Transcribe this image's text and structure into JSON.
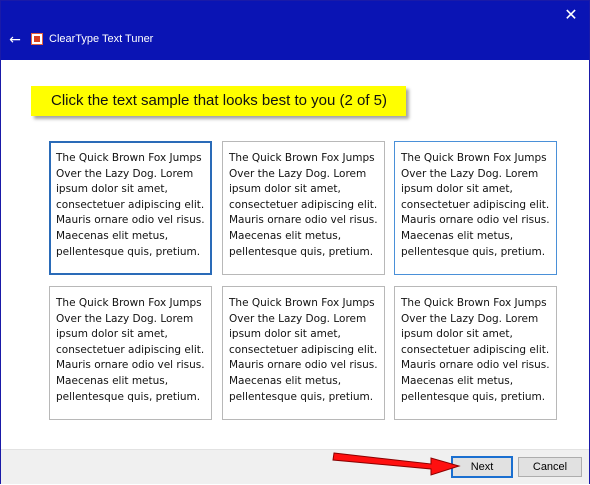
{
  "window": {
    "title": "ClearType Text Tuner",
    "close_glyph": "✕",
    "back_glyph": "←",
    "app_icon": "cleartype-app-icon"
  },
  "instruction": "Click the text sample that looks best to you (2 of 5)",
  "samples": [
    "The Quick Brown Fox Jumps\nOver the Lazy Dog. Lorem\nipsum dolor sit amet,\nconsectetuer adipiscing elit.\nMauris ornare odio vel risus.\nMaecenas elit metus,\npellentesque quis, pretium.",
    "The Quick Brown Fox Jumps\nOver the Lazy Dog. Lorem\nipsum dolor sit amet,\nconsectetuer adipiscing elit.\nMauris ornare odio vel risus.\nMaecenas elit metus,\npellentesque quis, pretium.",
    "The Quick Brown Fox Jumps\nOver the Lazy Dog. Lorem\nipsum dolor sit amet,\nconsectetuer adipiscing elit.\nMauris ornare odio vel risus.\nMaecenas elit metus,\npellentesque quis, pretium.",
    "The Quick Brown Fox Jumps\nOver the Lazy Dog. Lorem\nipsum dolor sit amet,\nconsectetuer adipiscing elit.\nMauris ornare odio vel risus.\nMaecenas elit metus,\npellentesque quis, pretium.",
    "The Quick Brown Fox Jumps\nOver the Lazy Dog. Lorem\nipsum dolor sit amet,\nconsectetuer adipiscing elit.\nMauris ornare odio vel risus.\nMaecenas elit metus,\npellentesque quis, pretium.",
    "The Quick Brown Fox Jumps\nOver the Lazy Dog. Lorem\nipsum dolor sit amet,\nconsectetuer adipiscing elit.\nMauris ornare odio vel risus.\nMaecenas elit metus,\npellentesque quis, pretium."
  ],
  "selected_sample": 1,
  "buttons": {
    "next": "Next",
    "cancel": "Cancel"
  },
  "colors": {
    "titlebar": "#0a14b4",
    "banner": "#ffff00",
    "selected_border": "#2a6bb8",
    "pointer_arrow": "#ff1010"
  }
}
